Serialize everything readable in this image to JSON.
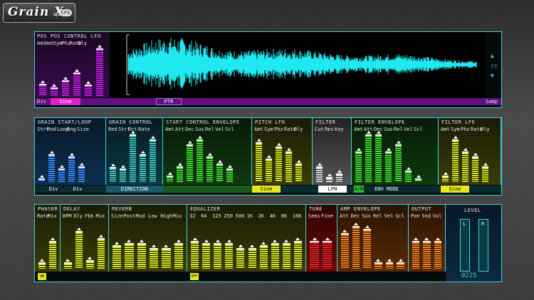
{
  "logo": {
    "title": "Grain X",
    "by": "by",
    "brand": "CFX"
  },
  "top": {
    "pos_label": "POS",
    "pos_control_lfo": "POS CONTROL LFO",
    "params": [
      "Amt",
      "Amt",
      "Sym",
      "Phz",
      "Rate",
      "Dly"
    ],
    "param_levels": [
      0.22,
      0.15,
      0.3,
      0.45,
      0.2,
      0.95
    ],
    "div_label": "Div",
    "lfo_shape": "Sine",
    "ptr": "PTR",
    "samp": "Samp"
  },
  "mid": {
    "grain_start_loop": {
      "title": "GRAIN START/LOOP",
      "params": [
        "Strt",
        "Rnd",
        "Loop",
        "Rng",
        "Size"
      ],
      "levels": [
        0.05,
        0.55,
        0.25,
        0.5,
        0.3
      ],
      "strip_a": "Div",
      "strip_b": "Div"
    },
    "grain_control": {
      "title": "GRAIN CONTROL",
      "params": [
        "Rnd",
        "Strt",
        "Oct",
        "Rate"
      ],
      "levels": [
        0.28,
        0.25,
        0.95,
        0.55,
        0.85
      ],
      "direction": "DIRECTION"
    },
    "start_control_envelope": {
      "title": "START CONTROL ENVELOPE",
      "params": [
        "Amt",
        "Att",
        "Dec",
        "Sus",
        "Rel",
        "Vel",
        "Scl"
      ],
      "levels": [
        0.1,
        0.3,
        0.75,
        0.85,
        0.5,
        0.35,
        0.25
      ]
    },
    "pitch_lfo": {
      "title": "PITCH LFO",
      "params": [
        "Amt",
        "Sym",
        "Phz",
        "Rate",
        "Dly"
      ],
      "levels": [
        0.8,
        0.45,
        0.7,
        0.6,
        0.35
      ],
      "shape": "Sine"
    },
    "filter": {
      "title": "FILTER",
      "params": [
        "Cut",
        "Res",
        "Key"
      ],
      "levels": [
        0.3,
        0.08,
        0.15
      ],
      "mode": "LPN"
    },
    "filter_envelope": {
      "title": "FILTER ENVELOPE",
      "params": [
        "Amt",
        "Att",
        "Dec",
        "Sus",
        "Rel",
        "Vel",
        "Scl"
      ],
      "levels": [
        0.6,
        0.95,
        0.95,
        0.6,
        0.75,
        0.2,
        0.05
      ],
      "env_mode": "ENV MODE",
      "env_mode_prefix": "A/R"
    },
    "filter_lfo": {
      "title": "FILTER LFO",
      "params": [
        "Amt",
        "Sym",
        "Phz",
        "Rate",
        "Dly"
      ],
      "levels": [
        0.1,
        0.85,
        0.6,
        0.5,
        0.3
      ],
      "shape": "Sine"
    }
  },
  "bottom": {
    "phaser": {
      "title": "PHASER",
      "params": [
        "Rate",
        "Mix"
      ],
      "levels": [
        0.1,
        0.55
      ],
      "toggle": "ON"
    },
    "delay": {
      "title": "DELAY",
      "params": [
        "BPM",
        "Dly",
        "Fbk",
        "Mix"
      ],
      "levels": [
        0.1,
        0.75,
        0.15,
        0.6
      ]
    },
    "reverb": {
      "title": "REVERB",
      "params": [
        "Size",
        "Post",
        "Mod",
        "Low",
        "High",
        "Mix"
      ],
      "levels": [
        0.45,
        0.5,
        0.5,
        0.4,
        0.4,
        0.5
      ]
    },
    "equalizer": {
      "title": "EQUALIZER",
      "params": [
        "32",
        "64",
        "125",
        "250",
        "500",
        "1K",
        "2K",
        "4K",
        "8K",
        "16K"
      ],
      "levels": [
        0.55,
        0.5,
        0.5,
        0.5,
        0.4,
        0.4,
        0.45,
        0.5,
        0.5,
        0.55
      ],
      "toggle": "OFF"
    },
    "tune": {
      "title": "TUNE",
      "params": [
        "Semi",
        "Fine"
      ],
      "levels": [
        0.55,
        0.55
      ]
    },
    "amp_envelope": {
      "title": "AMP ENVELOPE",
      "params": [
        "Att",
        "Dec",
        "Sus",
        "Rel",
        "Vel",
        "Scl"
      ],
      "levels": [
        0.7,
        0.85,
        0.8,
        0.1,
        0.1,
        0.1
      ]
    },
    "output": {
      "title": "OUTPUT",
      "params": [
        "Pan",
        "Snd",
        "Vol"
      ],
      "levels": [
        0.55,
        0.55,
        0.55
      ]
    },
    "level": {
      "title": "LEVEL",
      "left": "L",
      "right": "R",
      "readout": "0225"
    }
  },
  "colors": {
    "cyan": "#3fd3d3",
    "purple": "#c020e0",
    "blue": "#3a8aff",
    "teal": "#40c8c8",
    "green": "#40e030",
    "yellow": "#d8e820",
    "red": "#e82020",
    "orange": "#f08020",
    "waveform": "#20e8f0"
  }
}
